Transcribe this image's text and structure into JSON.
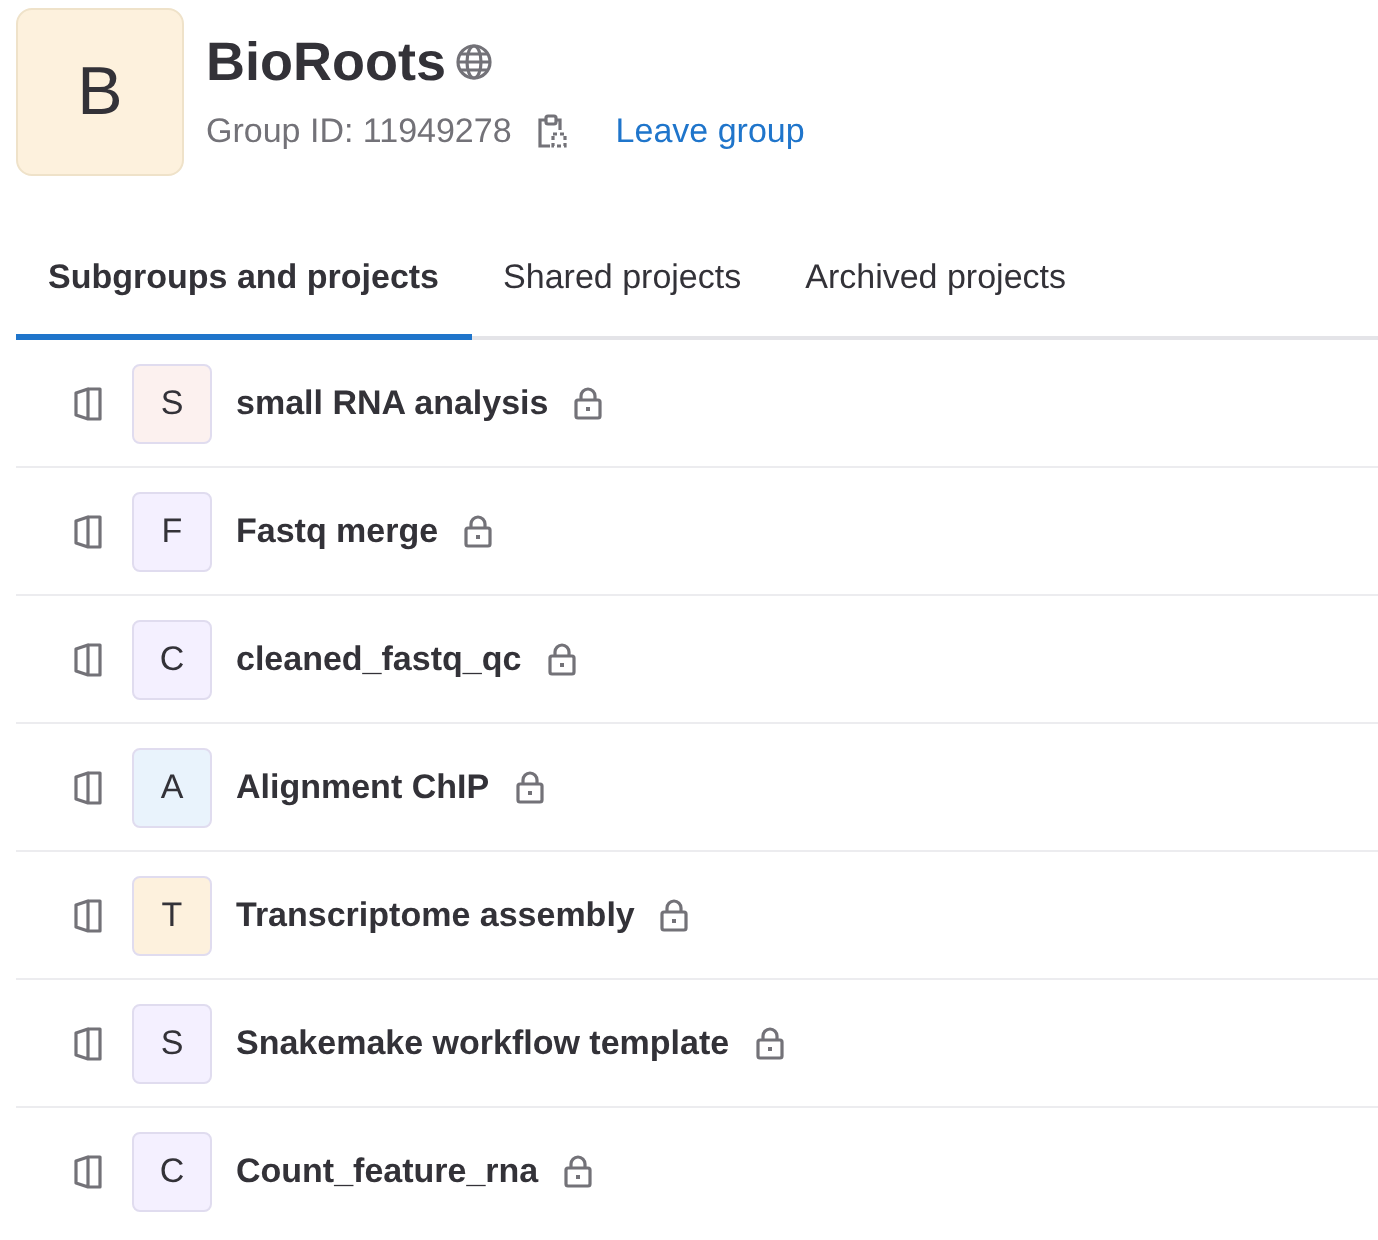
{
  "group": {
    "avatar_letter": "B",
    "name": "BioRoots",
    "group_id": "Group ID: 11949278",
    "leave_link": "Leave group"
  },
  "tabs": [
    {
      "label": "Subgroups and projects",
      "selected": true
    },
    {
      "label": "Shared projects",
      "selected": false
    },
    {
      "label": "Archived projects",
      "selected": false
    }
  ],
  "projects": [
    {
      "letter": "S",
      "name": "small RNA analysis",
      "color": "#fcf1ef"
    },
    {
      "letter": "F",
      "name": "Fastq merge",
      "color": "#f4f0ff"
    },
    {
      "letter": "C",
      "name": "cleaned_fastq_qc",
      "color": "#f4f0ff"
    },
    {
      "letter": "A",
      "name": "Alignment ChIP",
      "color": "#e9f3fc"
    },
    {
      "letter": "T",
      "name": "Transcriptome assembly",
      "color": "#fdf1dd"
    },
    {
      "letter": "S",
      "name": "Snakemake workflow template",
      "color": "#f4f0ff"
    },
    {
      "letter": "C",
      "name": "Count_feature_rna",
      "color": "#f4f0ff"
    }
  ]
}
